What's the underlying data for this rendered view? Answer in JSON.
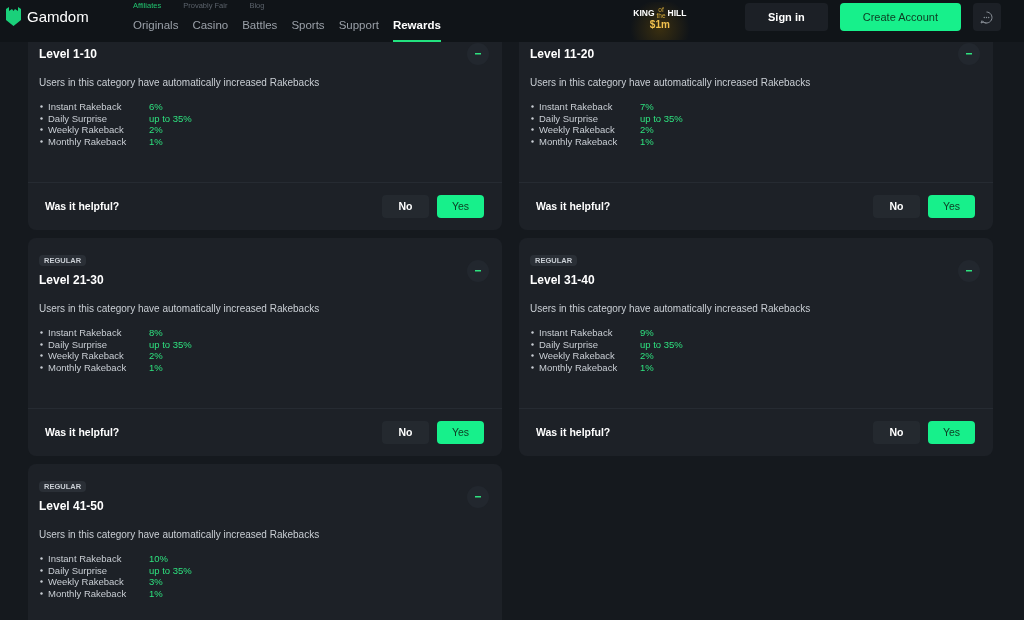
{
  "header": {
    "brand": "Gamdom",
    "top_links": [
      {
        "label": "Affiliates",
        "selected": true
      },
      {
        "label": "Provably Fair",
        "selected": false
      },
      {
        "label": "Blog",
        "selected": false
      }
    ],
    "nav": [
      {
        "label": "Originals",
        "selected": false
      },
      {
        "label": "Casino",
        "selected": false
      },
      {
        "label": "Battles",
        "selected": false
      },
      {
        "label": "Sports",
        "selected": false
      },
      {
        "label": "Support",
        "selected": false
      },
      {
        "label": "Rewards",
        "selected": true
      }
    ],
    "promo": {
      "line1_left": "KING",
      "small_top": "of",
      "small_bottom": "the",
      "line1_right": "HILL",
      "amount": "$1m"
    },
    "sign_in": "Sign in",
    "create_account": "Create Account"
  },
  "cards": [
    {
      "title": "Level 1-10",
      "description": "Users in this category have automatically increased Rakebacks",
      "perks": [
        {
          "label": "Instant Rakeback",
          "value": "6%"
        },
        {
          "label": "Daily Surprise",
          "value": "up to 35%"
        },
        {
          "label": "Weekly Rakeback",
          "value": "2%"
        },
        {
          "label": "Monthly Rakeback",
          "value": "1%"
        }
      ],
      "feedback": {
        "question": "Was it helpful?",
        "no": "No",
        "yes": "Yes"
      }
    },
    {
      "title": "Level 11-20",
      "description": "Users in this category have automatically increased Rakebacks",
      "perks": [
        {
          "label": "Instant Rakeback",
          "value": "7%"
        },
        {
          "label": "Daily Surprise",
          "value": "up to 35%"
        },
        {
          "label": "Weekly Rakeback",
          "value": "2%"
        },
        {
          "label": "Monthly Rakeback",
          "value": "1%"
        }
      ],
      "feedback": {
        "question": "Was it helpful?",
        "no": "No",
        "yes": "Yes"
      }
    },
    {
      "badge": "REGULAR",
      "title": "Level 21-30",
      "description": "Users in this category have automatically increased Rakebacks",
      "perks": [
        {
          "label": "Instant Rakeback",
          "value": "8%"
        },
        {
          "label": "Daily Surprise",
          "value": "up to 35%"
        },
        {
          "label": "Weekly Rakeback",
          "value": "2%"
        },
        {
          "label": "Monthly Rakeback",
          "value": "1%"
        }
      ],
      "feedback": {
        "question": "Was it helpful?",
        "no": "No",
        "yes": "Yes"
      }
    },
    {
      "badge": "REGULAR",
      "title": "Level 31-40",
      "description": "Users in this category have automatically increased Rakebacks",
      "perks": [
        {
          "label": "Instant Rakeback",
          "value": "9%"
        },
        {
          "label": "Daily Surprise",
          "value": "up to 35%"
        },
        {
          "label": "Weekly Rakeback",
          "value": "2%"
        },
        {
          "label": "Monthly Rakeback",
          "value": "1%"
        }
      ],
      "feedback": {
        "question": "Was it helpful?",
        "no": "No",
        "yes": "Yes"
      }
    },
    {
      "badge": "REGULAR",
      "title": "Level 41-50",
      "description": "Users in this category have automatically increased Rakebacks",
      "perks": [
        {
          "label": "Instant Rakeback",
          "value": "10%"
        },
        {
          "label": "Daily Surprise",
          "value": "up to 35%"
        },
        {
          "label": "Weekly Rakeback",
          "value": "3%"
        },
        {
          "label": "Monthly Rakeback",
          "value": "1%"
        }
      ]
    }
  ]
}
